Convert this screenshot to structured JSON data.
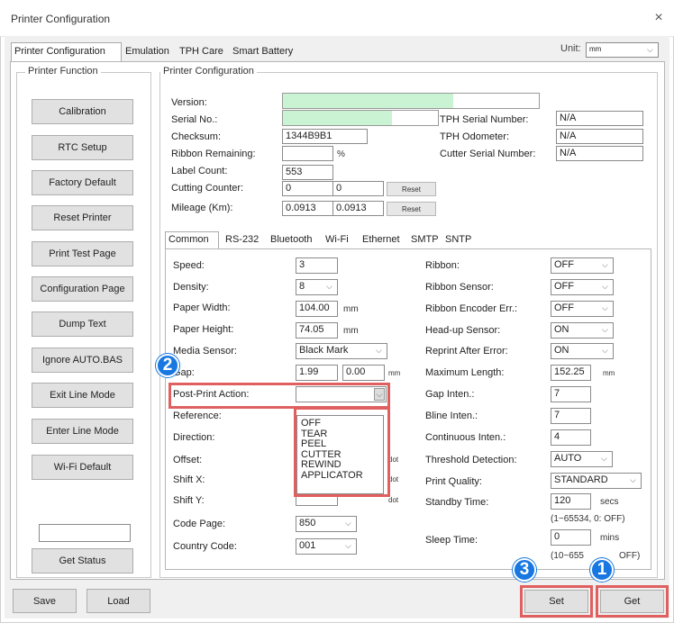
{
  "window": {
    "title": "Printer Configuration",
    "close": "×"
  },
  "tabs": [
    "Printer Configuration",
    "Emulation",
    "TPH Care",
    "Smart Battery"
  ],
  "unit": {
    "label": "Unit:",
    "value": "mm"
  },
  "printer_function": {
    "label": "Printer Function",
    "buttons": [
      "Calibration",
      "RTC Setup",
      "Factory Default",
      "Reset Printer",
      "Print Test Page",
      "Configuration Page",
      "Dump Text",
      "Ignore AUTO.BAS",
      "Exit Line Mode",
      "Enter Line Mode",
      "Wi-Fi Default"
    ],
    "status_value": "",
    "get_status": "Get Status"
  },
  "config": {
    "label": "Printer Configuration",
    "version_label": "Version:",
    "serial_label": "Serial No.:",
    "checksum_label": "Checksum:",
    "checksum_value": "1344B9B1",
    "ribbon_remaining_label": "Ribbon Remaining:",
    "ribbon_remaining_value": "",
    "percent": "%",
    "label_count_label": "Label Count:",
    "label_count_value": "553",
    "cutting_counter_label": "Cutting Counter:",
    "cutting_counter_value1": "0",
    "cutting_counter_value2": "0",
    "mileage_label": "Mileage (Km):",
    "mileage_value1": "0.0913",
    "mileage_value2": "0.0913",
    "reset": "Reset",
    "tph_serial_label": "TPH Serial Number:",
    "tph_serial_value": "N/A",
    "tph_odometer_label": "TPH Odometer:",
    "tph_odometer_value": "N/A",
    "cutter_serial_label": "Cutter Serial Number:",
    "cutter_serial_value": "N/A"
  },
  "subtabs": [
    "Common",
    "RS-232",
    "Bluetooth",
    "Wi-Fi",
    "Ethernet",
    "SMTP",
    "SNTP"
  ],
  "common": {
    "speed_label": "Speed:",
    "speed_value": "3",
    "density_label": "Density:",
    "density_value": "8",
    "paper_width_label": "Paper Width:",
    "paper_width_value": "104.00",
    "mm": "mm",
    "paper_height_label": "Paper Height:",
    "paper_height_value": "74.05",
    "media_sensor_label": "Media Sensor:",
    "media_sensor_value": "Black Mark",
    "gap_label": "Gap:",
    "gap_value1": "1.99",
    "gap_value2": "0.00",
    "post_print_label": "Post-Print Action:",
    "post_print_value": "",
    "post_print_options": [
      "OFF",
      "TEAR",
      "PEEL",
      "CUTTER",
      "REWIND",
      "APPLICATOR"
    ],
    "reference_label": "Reference:",
    "direction_label": "Direction:",
    "offset_label": "Offset:",
    "shiftx_label": "Shift X:",
    "shifty_label": "Shift Y:",
    "dot": "dot",
    "code_page_label": "Code Page:",
    "code_page_value": "850",
    "country_code_label": "Country Code:",
    "country_code_value": "001",
    "ribbon_label": "Ribbon:",
    "ribbon_value": "OFF",
    "ribbon_sensor_label": "Ribbon Sensor:",
    "ribbon_sensor_value": "OFF",
    "ribbon_encoder_label": "Ribbon Encoder Err.:",
    "ribbon_encoder_value": "OFF",
    "headup_label": "Head-up Sensor:",
    "headup_value": "ON",
    "reprint_label": "Reprint After Error:",
    "reprint_value": "ON",
    "max_length_label": "Maximum Length:",
    "max_length_value": "152.25",
    "gap_inten_label": "Gap Inten.:",
    "gap_inten_value": "7",
    "bline_inten_label": "Bline Inten.:",
    "bline_inten_value": "7",
    "cont_inten_label": "Continuous Inten.:",
    "cont_inten_value": "4",
    "threshold_label": "Threshold Detection:",
    "threshold_value": "AUTO",
    "print_quality_label": "Print Quality:",
    "print_quality_value": "STANDARD",
    "standby_label": "Standby Time:",
    "standby_value": "120",
    "secs": "secs",
    "standby_hint": "(1~65534, 0: OFF)",
    "sleep_label": "Sleep Time:",
    "sleep_value": "0",
    "mins": "mins",
    "sleep_hint_a": "(10~655",
    "sleep_hint_b": "OFF)"
  },
  "footer": {
    "save": "Save",
    "load": "Load",
    "set": "Set",
    "get": "Get"
  },
  "badges": {
    "one": "1",
    "two": "2",
    "three": "3"
  },
  "colors": {
    "badge": "#1877e0",
    "highlight": "#e06060",
    "progress": "#c9f3d2"
  }
}
